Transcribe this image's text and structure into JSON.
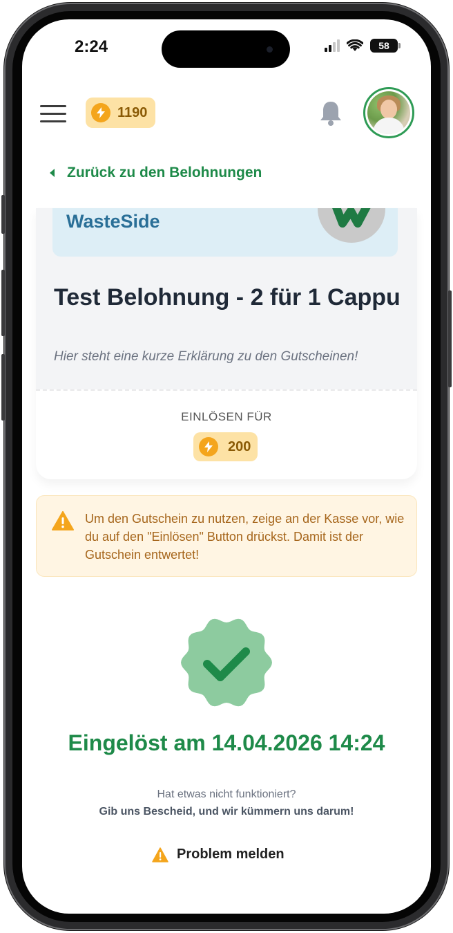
{
  "status_bar": {
    "time": "2:24",
    "battery": "58"
  },
  "header": {
    "coin_balance": "1190",
    "menu_icon": "hamburger-icon",
    "bell_icon": "bell-icon"
  },
  "nav": {
    "back_label": "Zurück zu den Belohnungen"
  },
  "card": {
    "brand": "WasteSide",
    "title": "Test Belohnung - 2 für 1 Cappu",
    "description": "Hier steht eine kurze Erklärung zu den Gutscheinen!",
    "redeem_label": "EINLÖSEN FÜR",
    "cost": "200"
  },
  "warning": {
    "text": "Um den Gutschein zu nutzen, zeige an der Kasse vor, wie du auf den \"Einlösen\" Button drückst. Damit ist der Gutschein entwertet!"
  },
  "success": {
    "redeemed_text": "Eingelöst am 14.04.2026 14:24"
  },
  "help": {
    "line1": "Hat etwas nicht funktioniert?",
    "line2": "Gib uns Bescheid, und wir kümmern uns darum!",
    "report_label": "Problem melden"
  },
  "colors": {
    "brand_green": "#1e8a49",
    "coin_orange": "#f4a51c",
    "coin_pill": "#fde2a5",
    "warning_bg": "#fff5e3",
    "warning_text": "#a6661c",
    "badge_green": "#8dcb9f"
  }
}
